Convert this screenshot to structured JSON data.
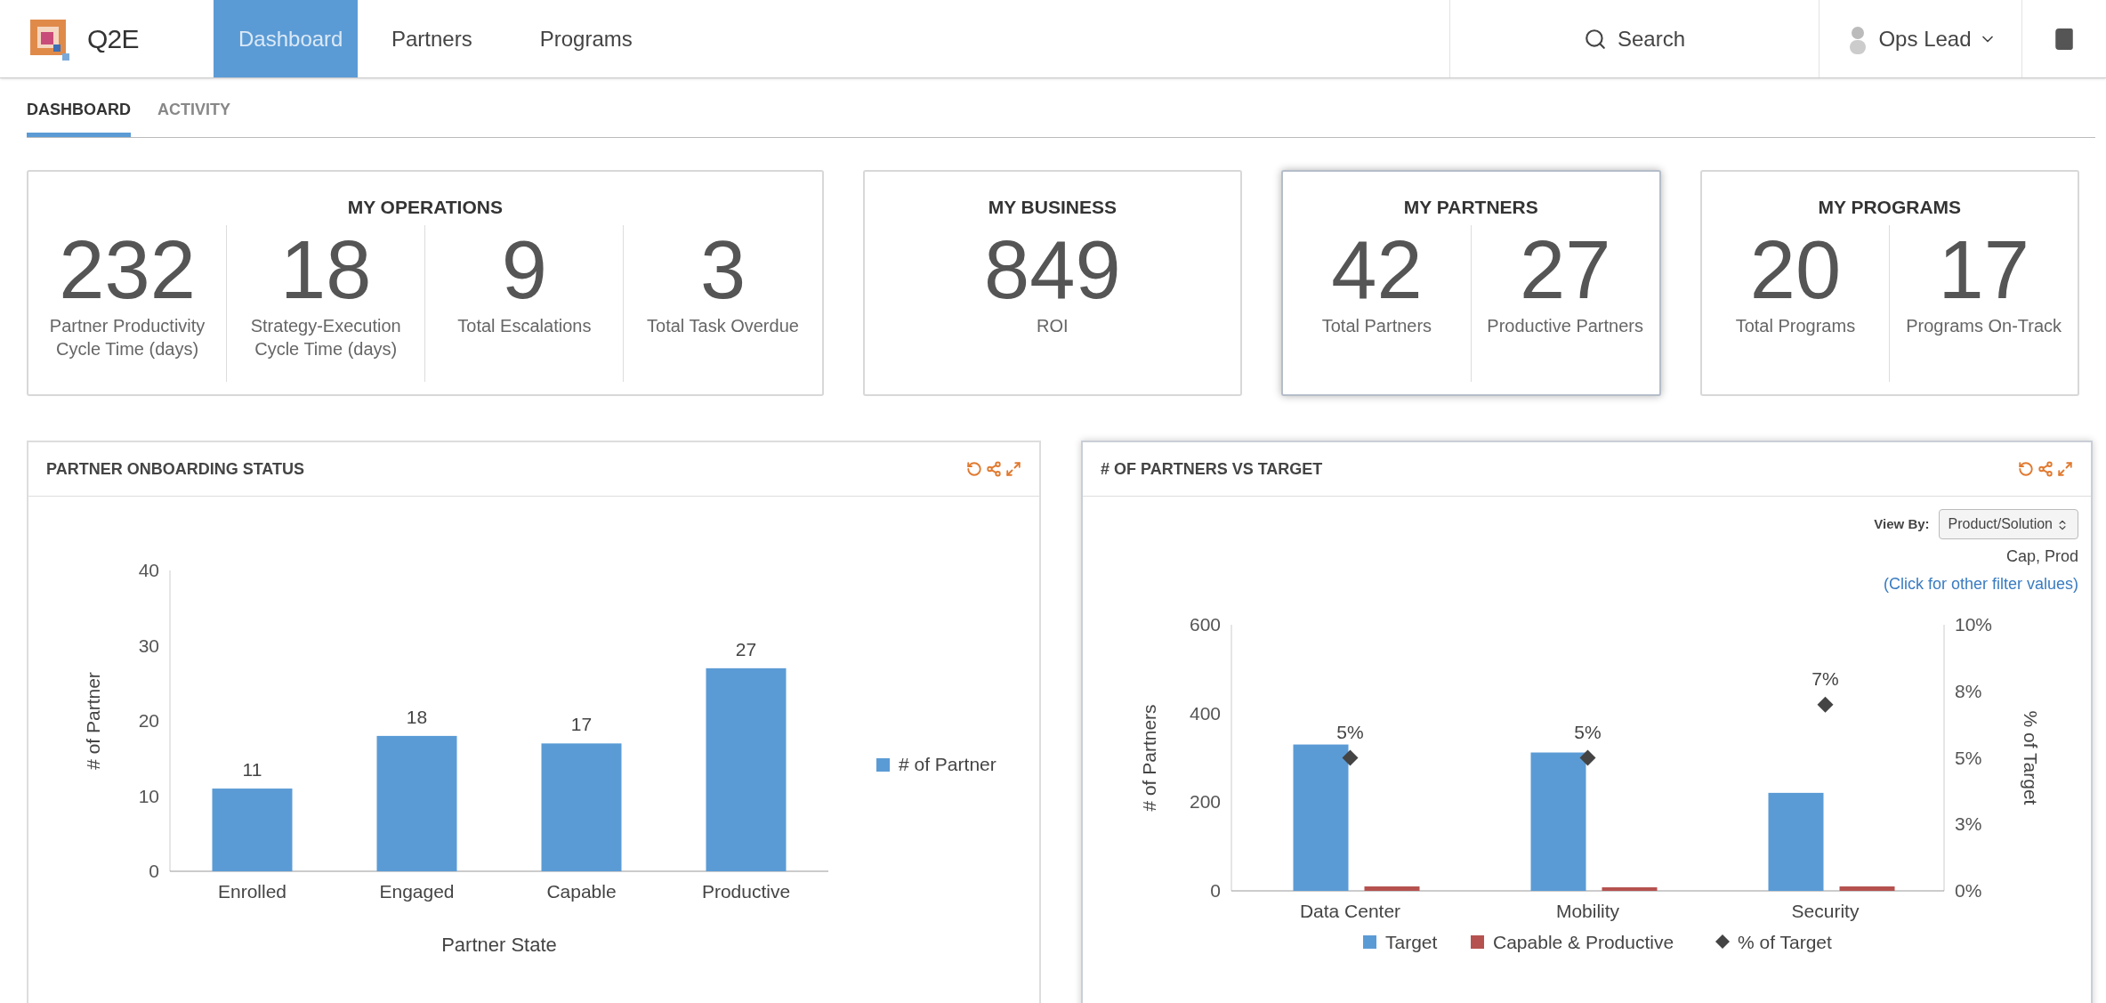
{
  "header": {
    "logo_text": "Q2E",
    "nav": [
      {
        "label": "Dashboard",
        "selected": true
      },
      {
        "label": "Partners",
        "selected": false
      },
      {
        "label": "Programs",
        "selected": false
      }
    ],
    "search": "Search",
    "user": "Ops Lead"
  },
  "subtabs": [
    {
      "label": "DASHBOARD",
      "selected": true
    },
    {
      "label": "ACTIVITY",
      "selected": false
    }
  ],
  "kpi_cards": [
    {
      "title": "MY OPERATIONS",
      "selected": false,
      "metrics": [
        {
          "value": "232",
          "label": "Partner Productivity Cycle Time (days)"
        },
        {
          "value": "18",
          "label": "Strategy-Execution Cycle Time (days)"
        },
        {
          "value": "9",
          "label": "Total Escalations"
        },
        {
          "value": "3",
          "label": "Total Task Overdue"
        }
      ]
    },
    {
      "title": "MY BUSINESS",
      "selected": false,
      "metrics": [
        {
          "value": "849",
          "label": "ROI"
        }
      ]
    },
    {
      "title": "MY PARTNERS",
      "selected": true,
      "metrics": [
        {
          "value": "42",
          "label": "Total Partners"
        },
        {
          "value": "27",
          "label": "Productive Partners"
        }
      ]
    },
    {
      "title": "MY PROGRAMS",
      "selected": false,
      "metrics": [
        {
          "value": "20",
          "label": "Total Programs"
        },
        {
          "value": "17",
          "label": "Programs On-Track"
        }
      ]
    }
  ],
  "panels": [
    {
      "title": "PARTNER ONBOARDING STATUS",
      "chart_data": {
        "type": "bar",
        "xlabel": "Partner State",
        "ylabel": "# of Partner",
        "categories": [
          "Enrolled",
          "Engaged",
          "Capable",
          "Productive"
        ],
        "ylim": [
          0,
          40
        ],
        "yticks": [
          0,
          10,
          20,
          30,
          40
        ],
        "data_labels": true,
        "series": [
          {
            "name": "# of Partner",
            "color": "#5b9bd5",
            "values": [
              11,
              18,
              17,
              27
            ]
          }
        ]
      }
    },
    {
      "title": "# OF PARTNERS VS TARGET",
      "view_by": {
        "label": "View By:",
        "value": "Product/Solution"
      },
      "filter_values": "Cap, Prod",
      "filter_link": "(Click for other filter values)",
      "chart_data": {
        "type": "bar",
        "ylabel": "# of Partners",
        "y2label": "% of Target",
        "categories": [
          "Data Center",
          "Mobility",
          "Security"
        ],
        "ylim": [
          0,
          600
        ],
        "yticks": [
          0,
          200,
          400,
          600
        ],
        "y2lim": [
          0,
          10
        ],
        "y2ticks": [
          {
            "value": 0,
            "label": "0%"
          },
          {
            "value": 2.5,
            "label": "3%"
          },
          {
            "value": 5,
            "label": "5%"
          },
          {
            "value": 7.5,
            "label": "8%"
          },
          {
            "value": 10,
            "label": "10%"
          }
        ],
        "stacked": false,
        "legend": "bottom",
        "series": [
          {
            "name": "Target",
            "type": "bar",
            "color": "#5b9bd5",
            "values": [
              330,
              312,
              221
            ]
          },
          {
            "name": "Capable & Productive",
            "type": "bar",
            "color": "#b5524f",
            "values": [
              10,
              8,
              10
            ]
          },
          {
            "name": "% of Target",
            "type": "scatter",
            "axis": "y2",
            "color": "#444444",
            "values": [
              5,
              5,
              7
            ],
            "value_labels": [
              "5%",
              "5%",
              "7%"
            ]
          }
        ]
      }
    }
  ]
}
